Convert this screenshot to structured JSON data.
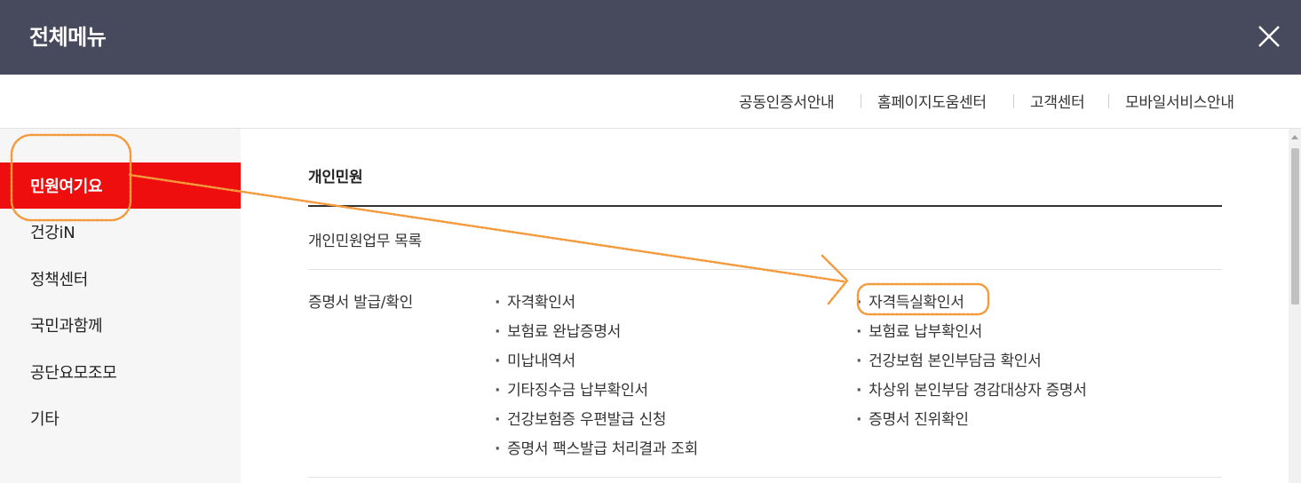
{
  "header": {
    "title": "전체메뉴",
    "close_icon": "close-icon"
  },
  "util_links": [
    "공동인증서안내",
    "홈페이지도움센터",
    "고객센터",
    "모바일서비스안내"
  ],
  "sidebar": {
    "items": [
      {
        "label": "민원여기요",
        "active": true
      },
      {
        "label": "건강iN"
      },
      {
        "label": "정책센터"
      },
      {
        "label": "국민과함께"
      },
      {
        "label": "공단요모조모"
      },
      {
        "label": "기타"
      }
    ]
  },
  "content": {
    "section_title": "개인민원",
    "rows": [
      {
        "title": "개인민원업무 목록"
      },
      {
        "title": "증명서 발급/확인",
        "col1": [
          "자격확인서",
          "보험료 완납증명서",
          "미납내역서",
          "기타징수금 납부확인서",
          "건강보험증 우편발급 신청",
          "증명서 팩스발급 처리결과 조회"
        ],
        "col2": [
          "자격득실확인서",
          "보험료 납부확인서",
          "건강보험 본인부담금 확인서",
          "차상위 본인부담 경감대상자 증명서",
          "증명서 진위확인"
        ]
      }
    ]
  },
  "colors": {
    "header_bg": "#474a5c",
    "active_bg": "#ee0e0e",
    "annotation": "#f39a3c"
  }
}
